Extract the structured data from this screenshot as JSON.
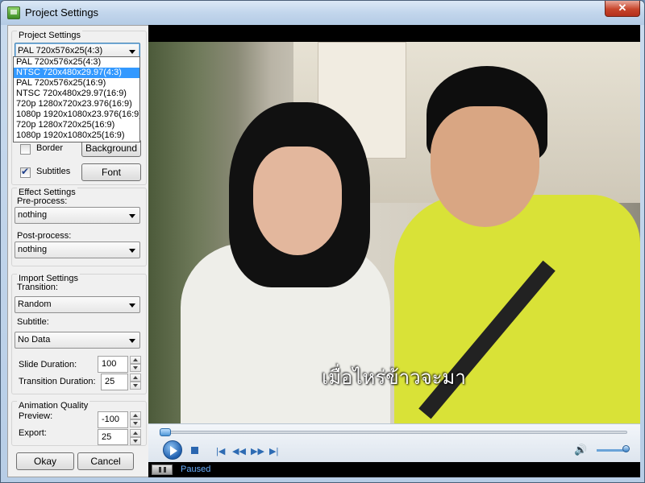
{
  "window": {
    "title": "Project Settings",
    "close_glyph": "✕"
  },
  "project_settings": {
    "group_label": "Project Settings",
    "format_value": "PAL 720x576x25(4:3)",
    "format_options": [
      "PAL 720x576x25(4:3)",
      "NTSC 720x480x29.97(4:3)",
      "PAL 720x576x25(16:9)",
      "NTSC 720x480x29.97(16:9)",
      "720p 1280x720x23.976(16:9)",
      "1080p 1920x1080x23.976(16:9)",
      "720p 1280x720x25(16:9)",
      "1080p 1920x1080x25(16:9)"
    ],
    "selected_option_index": 1,
    "border_label": "Border",
    "border_checked": false,
    "background_button": "Background",
    "subtitles_label": "Subtitles",
    "subtitles_checked": true,
    "font_button": "Font"
  },
  "effect_settings": {
    "group_label": "Effect Settings",
    "preprocess_label": "Pre-process:",
    "preprocess_value": "nothing",
    "postprocess_label": "Post-process:",
    "postprocess_value": "nothing"
  },
  "import_settings": {
    "group_label": "Import Settings",
    "transition_label": "Transition:",
    "transition_value": "Random",
    "subtitle_label": "Subtitle:",
    "subtitle_value": "No Data",
    "slide_duration_label": "Slide Duration:",
    "slide_duration_value": "100",
    "transition_duration_label": "Transition Duration:",
    "transition_duration_value": "25"
  },
  "animation_quality": {
    "group_label": "Animation Quality",
    "preview_label": "Preview:",
    "preview_value": "-100",
    "export_label": "Export:",
    "export_value": "25"
  },
  "buttons": {
    "okay": "Okay",
    "cancel": "Cancel"
  },
  "player": {
    "subtitle_text": "เมื่อไหร่ข้าวจะมา",
    "status": "Paused",
    "icons": {
      "play": "play-icon",
      "stop": "stop-icon",
      "previous": "skip-previous-icon",
      "rewind": "rewind-icon",
      "fast_forward": "fast-forward-icon",
      "next": "skip-next-icon",
      "volume": "speaker-icon",
      "pause": "pause-icon"
    },
    "glyphs": {
      "previous": "|◀",
      "rewind": "◀◀",
      "fast_forward": "▶▶",
      "next": "▶|",
      "volume": "🔊"
    }
  },
  "colors": {
    "selection": "#3399ff",
    "status_text": "#6ab0ff",
    "accent": "#2d6bb3"
  }
}
